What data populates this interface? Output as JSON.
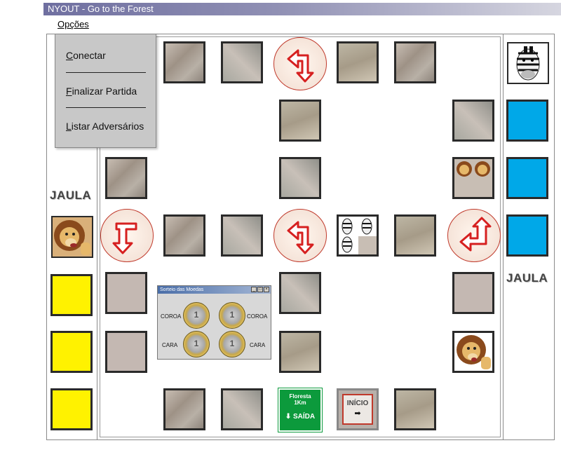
{
  "window": {
    "title": "NYOUT - Go to the Forest"
  },
  "menubar": {
    "options_label": "Opções"
  },
  "dropdown": {
    "items": [
      "Conectar",
      "Finalizar Partida",
      "Listar Adversários"
    ]
  },
  "jaula": {
    "left_label": "JAULA",
    "right_label": "JAULA"
  },
  "coin_window": {
    "title": "Sorteio das Moedas",
    "row1_left": "COROA",
    "row1_right": "COROA",
    "row2_left": "CARA",
    "row2_right": "CARA",
    "coin_value": "1"
  },
  "signs": {
    "saida_top": "Floresta",
    "saida_dist": "1Km",
    "saida_label": "SAÍDA",
    "inicio_label": "INÍCIO",
    "inicio_arrow": "➡"
  },
  "colors": {
    "player_blue": "#00a8e8",
    "player_yellow": "#fff200",
    "arrow_red": "#d62020"
  }
}
